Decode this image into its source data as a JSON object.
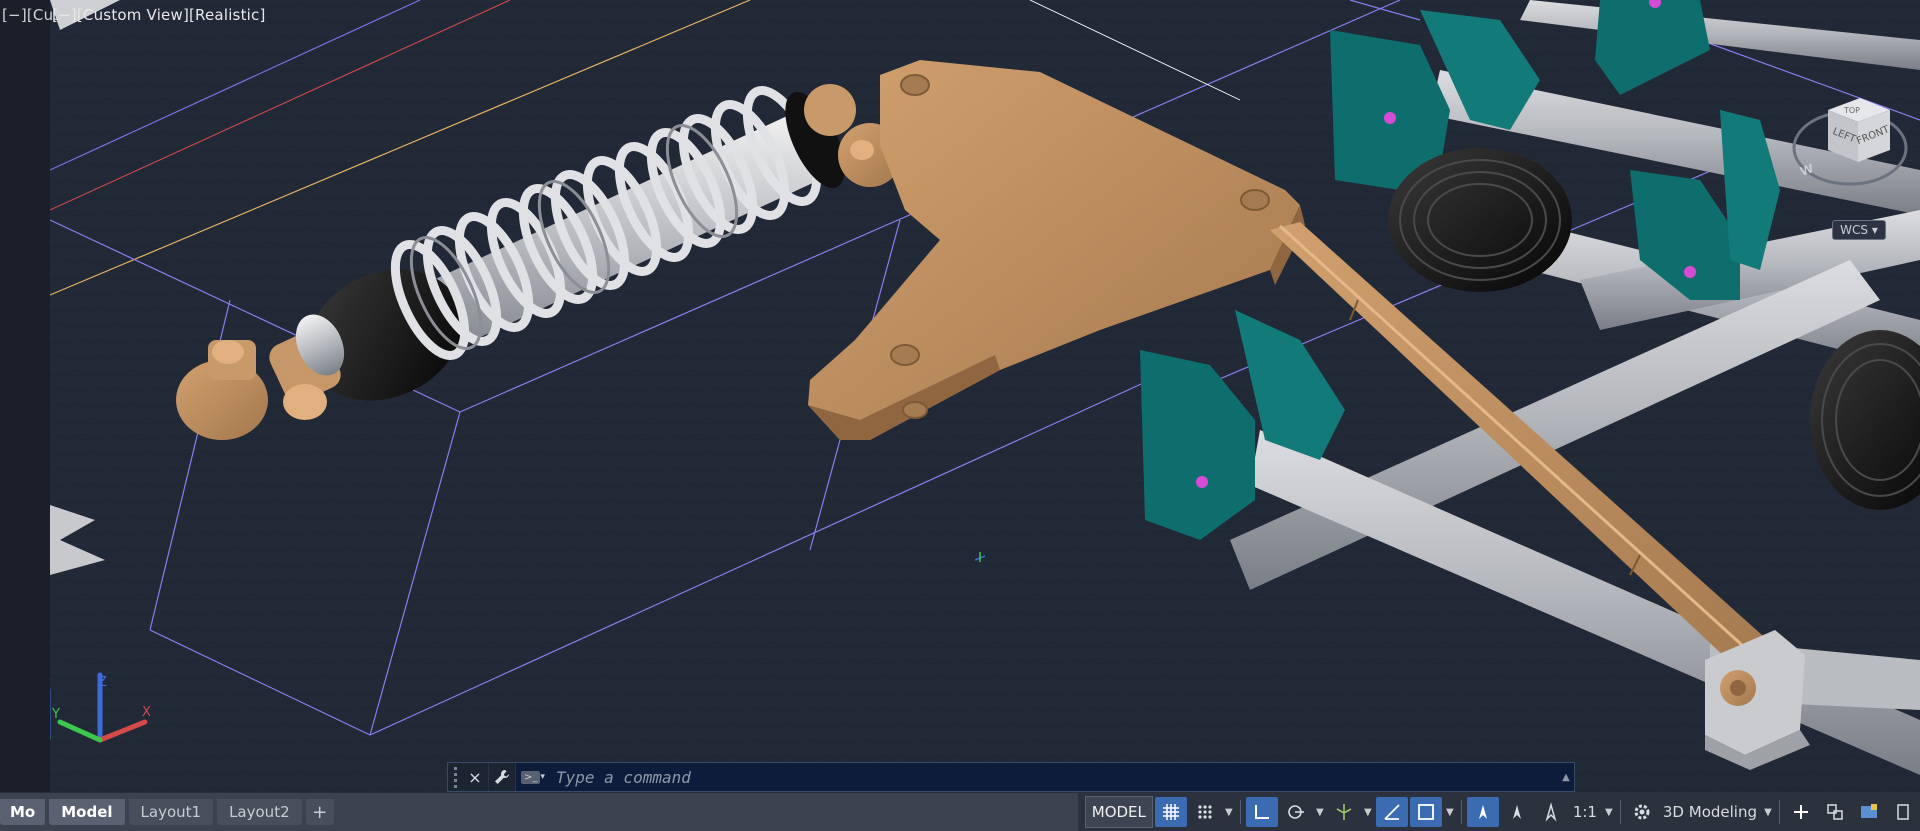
{
  "viewport": {
    "label_back": "[−][Cus",
    "label_front": "[−][Custom View][Realistic]",
    "viewcube": {
      "top": "TOP",
      "left": "LEFT",
      "front": "FRONT",
      "compass": "W"
    },
    "wcs_label": "WCS"
  },
  "command": {
    "placeholder": "Type a command",
    "close_icon": "×",
    "wrench_icon": "wrench-icon",
    "prompt_icon": ">_",
    "expand_icon": "▲"
  },
  "tabs": [
    {
      "label": "Mo"
    },
    {
      "label": "Model"
    },
    {
      "label": "Layout1"
    },
    {
      "label": "Layout2"
    },
    {
      "label": "+"
    }
  ],
  "status": {
    "model_label": "MODEL",
    "scale_label": "1:1",
    "workspace_label": "3D Modeling"
  },
  "colors": {
    "viewport_bg": "#212836",
    "bronze": "#b8875a",
    "teal": "#0e6e6e",
    "steel": "#c4c7cc",
    "status_active": "#3b6bb0"
  }
}
